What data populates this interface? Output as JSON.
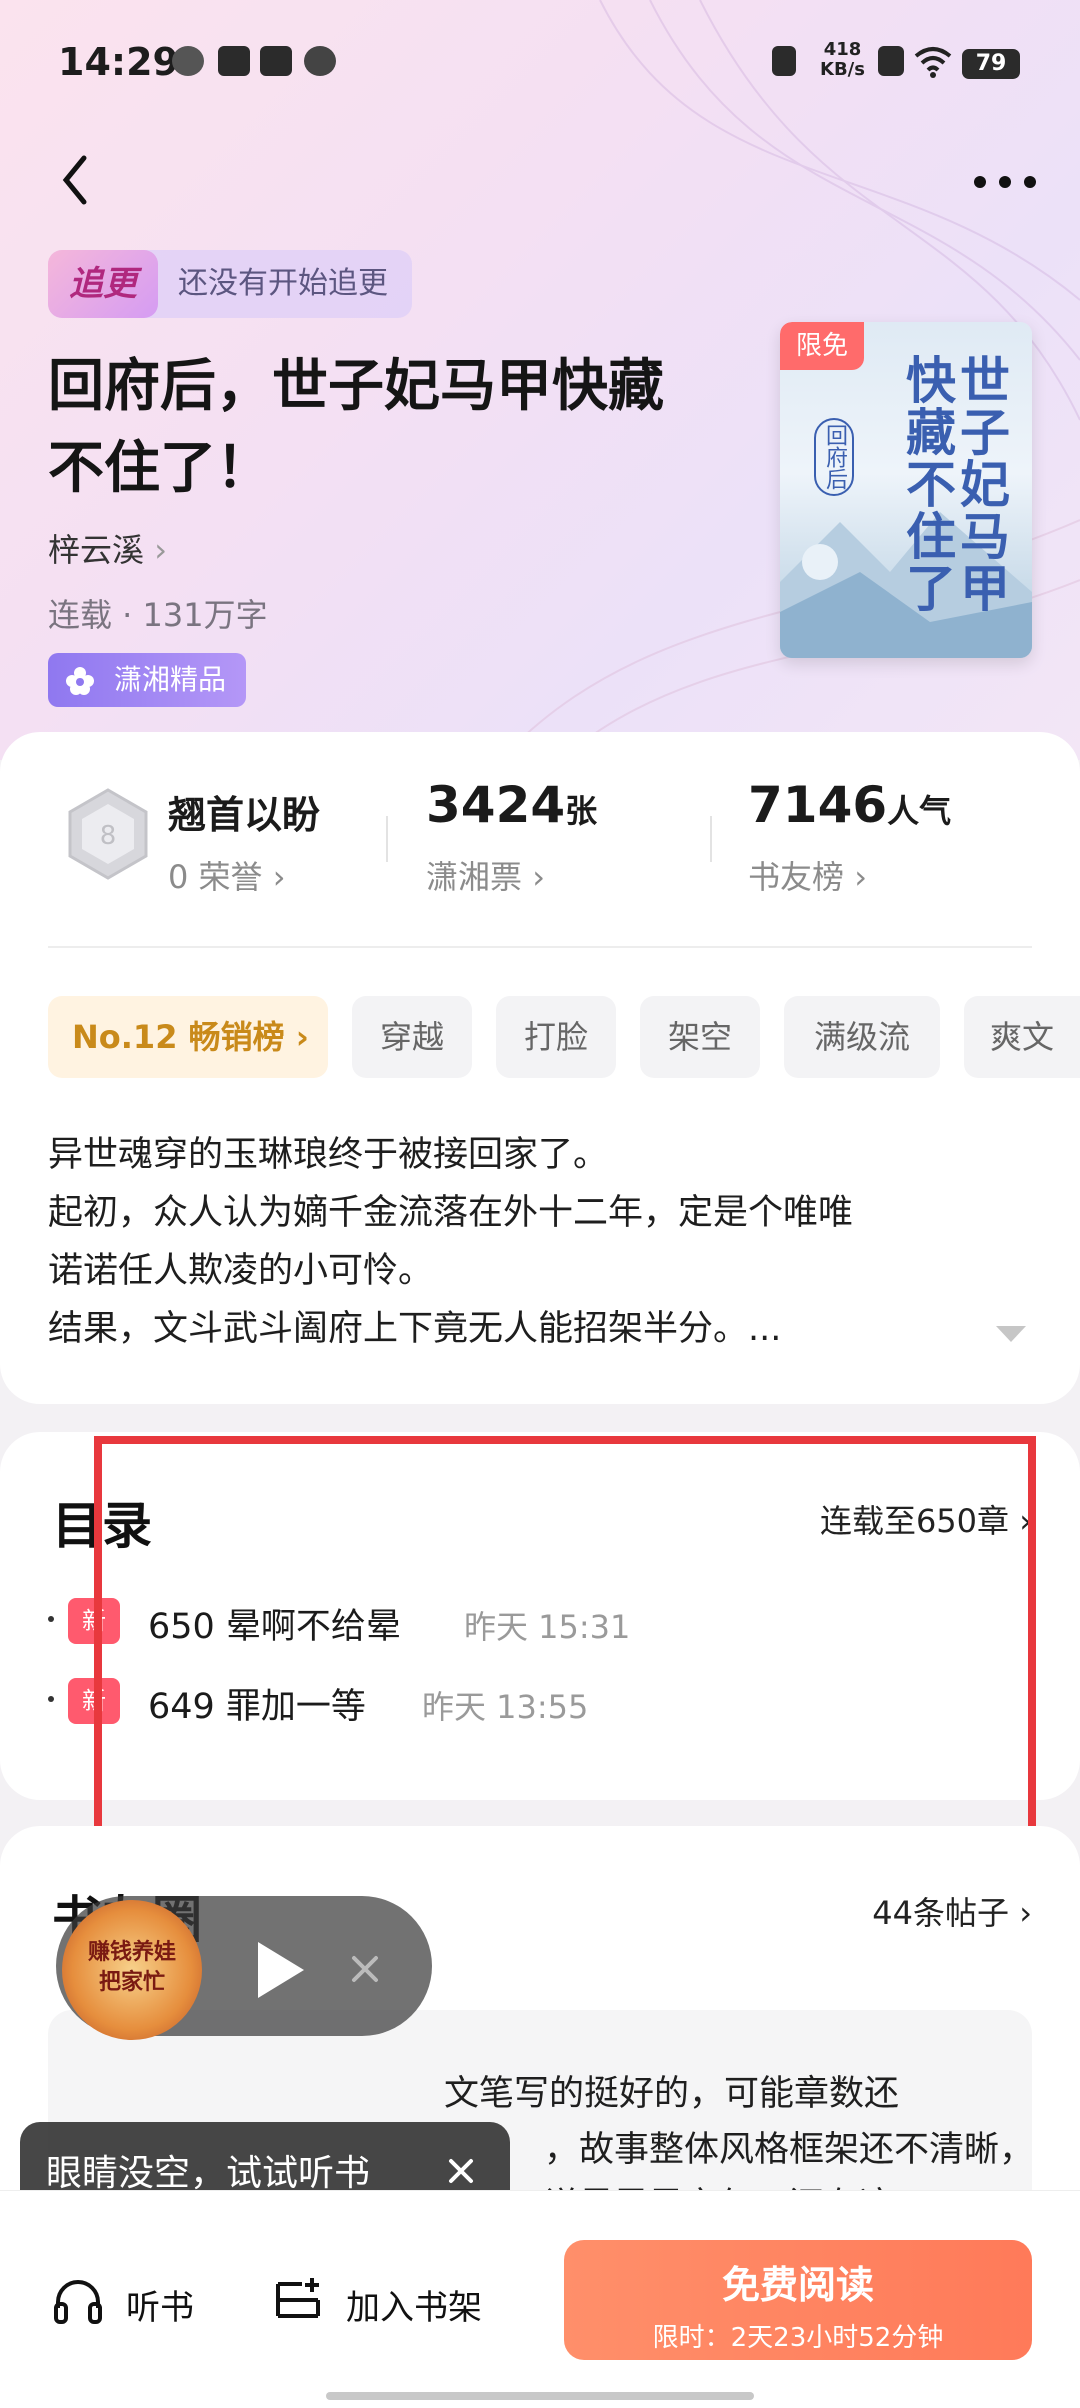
{
  "status_bar": {
    "time": "14:29",
    "net_speed_value": "418",
    "net_speed_unit": "KB/s",
    "battery": "79"
  },
  "header": {
    "follow_badge": "追更",
    "follow_status": "还没有开始追更"
  },
  "book": {
    "title_line1": "回府后，世子妃马甲快藏",
    "title_line2": "不住了！",
    "author": "梓云溪",
    "meta": "连载 · 131万字",
    "label": "潇湘精品",
    "cover_badge": "限免",
    "cover_title": "世子妃马甲快藏不住了",
    "cover_subtitle": "回府后"
  },
  "stats": {
    "honor_title": "翘首以盼",
    "honor_sub": "0 荣誉",
    "tickets_value": "3424",
    "tickets_unit": "张",
    "tickets_label": "潇湘票",
    "popularity_value": "7146",
    "popularity_unit": "人气",
    "popularity_label": "书友榜"
  },
  "tags": [
    "No.12 畅销榜",
    "穿越",
    "打脸",
    "架空",
    "满级流",
    "爽文"
  ],
  "synopsis": [
    "异世魂穿的玉琳琅终于被接回家了。",
    "起初，众人认为嫡千金流落在外十二年，定是个唯唯",
    "诺诺任人欺凌的小可怜。",
    "结果，文斗武斗阖府上下竟无人能招架半分。..."
  ],
  "toc": {
    "title": "目录",
    "link": "连载至650章",
    "new_badge": "新",
    "chapters": [
      {
        "title": "650 晕啊不给晕",
        "time": "昨天 15:31"
      },
      {
        "title": "649 罪加一等",
        "time": "昨天 13:55"
      }
    ]
  },
  "community": {
    "title": "书友圈",
    "link": "44条帖子",
    "post_lines": [
      "文笔写的挺好的，可能章数还",
      "，故事整体风格框架还不清晰，",
      "说是灵异玄幻，还有这..."
    ]
  },
  "mini_player": {
    "cover_text_line1": "赚钱养娃",
    "cover_text_line2": "把家忙",
    "toast": "眼睛没空，试试听书"
  },
  "bottom_bar": {
    "listen_label": "听书",
    "shelf_label": "加入书架",
    "read_label": "免费阅读",
    "read_sub": "限时：2天23小时52分钟"
  },
  "colors": {
    "accent": "#ff7a59",
    "new_badge": "#ff5a6e",
    "highlight_box": "#e8383d",
    "label_purple": "#8f78f0",
    "rank_gold": "#c98a1a"
  }
}
